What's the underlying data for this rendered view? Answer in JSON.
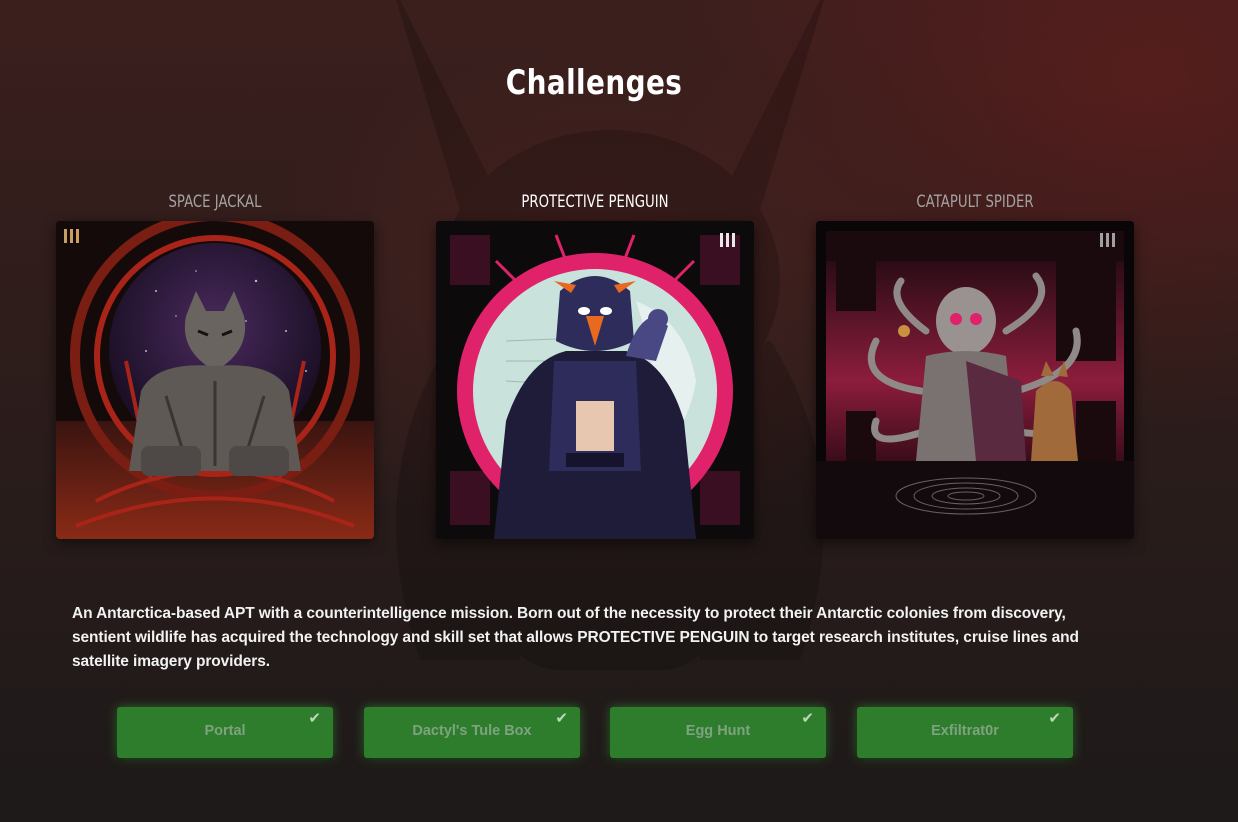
{
  "page": {
    "title": "Challenges"
  },
  "adversaries": [
    {
      "name": "SPACE JACKAL",
      "active": false,
      "icon": "space-jackal-portrait"
    },
    {
      "name": "PROTECTIVE PENGUIN",
      "active": true,
      "icon": "protective-penguin-portrait"
    },
    {
      "name": "CATAPULT SPIDER",
      "active": false,
      "icon": "catapult-spider-portrait"
    }
  ],
  "description": "An Antarctica-based APT with a counterintelligence mission. Born out of the necessity to protect their Antarctic colonies from discovery, sentient wildlife has acquired the technology and skill set that allows PROTECTIVE PENGUIN to target research institutes, cruise lines and satellite imagery providers.",
  "tasks": [
    {
      "label": "Portal",
      "completed": true,
      "check_icon": "✔"
    },
    {
      "label": "Dactyl's Tule Box",
      "completed": true,
      "check_icon": "✔"
    },
    {
      "label": "Egg Hunt",
      "completed": true,
      "check_icon": "✔"
    },
    {
      "label": "Exfiltrat0r",
      "completed": true,
      "check_icon": "✔"
    }
  ],
  "colors": {
    "task_completed": "#2d7d2d",
    "task_label": "#7fa27f",
    "penguin_ring": "#e0226b",
    "jackal_accent": "#a82418",
    "spider_accent": "#8c1d3c"
  }
}
